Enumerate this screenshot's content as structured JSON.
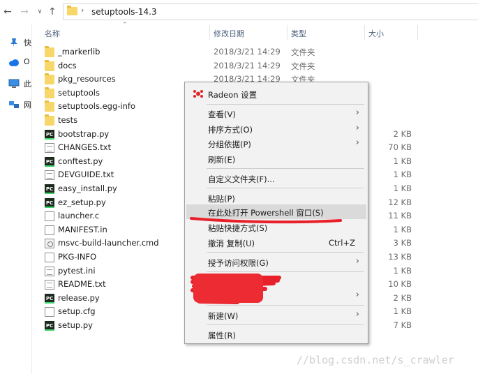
{
  "nav": {
    "back_icon": "arrow-left-icon",
    "forward_icon": "arrow-right-icon",
    "history_icon": "chevron-down-icon",
    "up_icon": "arrow-up-icon",
    "path": "setuptools-14.3"
  },
  "quick_access": [
    {
      "label": "快",
      "icon": "pin-icon"
    },
    {
      "label": "O",
      "icon": "cloud-icon"
    },
    {
      "label": "此",
      "icon": "computer-icon"
    },
    {
      "label": "网",
      "icon": "network-icon"
    }
  ],
  "columns": {
    "name": "名称",
    "date": "修改日期",
    "type": "类型",
    "size": "大小"
  },
  "files": [
    {
      "name": "_markerlib",
      "date": "2018/3/21 14:29",
      "type": "文件夹",
      "size": "",
      "icon": "folder"
    },
    {
      "name": "docs",
      "date": "2018/3/21 14:29",
      "type": "文件夹",
      "size": "",
      "icon": "folder"
    },
    {
      "name": "pkg_resources",
      "date": "2018/3/21 14:29",
      "type": "文件夹",
      "size": "",
      "icon": "folder"
    },
    {
      "name": "setuptools",
      "date": "",
      "type": "",
      "size": "",
      "icon": "folder"
    },
    {
      "name": "setuptools.egg-info",
      "date": "",
      "type": "",
      "size": "",
      "icon": "folder"
    },
    {
      "name": "tests",
      "date": "",
      "type": "",
      "size": "",
      "icon": "folder"
    },
    {
      "name": "bootstrap.py",
      "date": "",
      "type": "",
      "size": "2 KB",
      "icon": "pc"
    },
    {
      "name": "CHANGES.txt",
      "date": "",
      "type": "",
      "size": "70 KB",
      "icon": "txt"
    },
    {
      "name": "conftest.py",
      "date": "",
      "type": "",
      "size": "1 KB",
      "icon": "pc"
    },
    {
      "name": "DEVGUIDE.txt",
      "date": "",
      "type": "",
      "size": "1 KB",
      "icon": "txt"
    },
    {
      "name": "easy_install.py",
      "date": "",
      "type": "",
      "size": "1 KB",
      "icon": "pc"
    },
    {
      "name": "ez_setup.py",
      "date": "",
      "type": "",
      "size": "12 KB",
      "icon": "pc"
    },
    {
      "name": "launcher.c",
      "date": "",
      "type": "",
      "size": "11 KB",
      "icon": "blank"
    },
    {
      "name": "MANIFEST.in",
      "date": "",
      "type": "",
      "size": "1 KB",
      "icon": "blank"
    },
    {
      "name": "msvc-build-launcher.cmd",
      "date": "",
      "type": "",
      "size": "3 KB",
      "icon": "cmd"
    },
    {
      "name": "PKG-INFO",
      "date": "",
      "type": "",
      "size": "13 KB",
      "icon": "blank"
    },
    {
      "name": "pytest.ini",
      "date": "",
      "type": "",
      "size": "1 KB",
      "icon": "txt"
    },
    {
      "name": "README.txt",
      "date": "",
      "type": "",
      "size": "10 KB",
      "icon": "txt"
    },
    {
      "name": "release.py",
      "date": "",
      "type": "",
      "size": "2 KB",
      "icon": "pc"
    },
    {
      "name": "setup.cfg",
      "date": "",
      "type": "",
      "size": "1 KB",
      "icon": "blank"
    },
    {
      "name": "setup.py",
      "date": "",
      "type": "",
      "size": "7 KB",
      "icon": "pc"
    }
  ],
  "menu": {
    "radeon": "Radeon 设置",
    "view": "查看(V)",
    "sort": "排序方式(O)",
    "group": "分组依据(P)",
    "refresh": "刷新(E)",
    "customize": "自定义文件夹(F)...",
    "paste": "粘贴(P)",
    "powershell": "在此处打开 Powershell 窗口(S)",
    "paste_shortcut": "粘贴快捷方式(S)",
    "undo": "撤消 复制(U)",
    "undo_shortcut": "Ctrl+Z",
    "access": "授予访问权限(G)",
    "new": "新建(W)",
    "properties": "属性(R)",
    "submenu_icon": "chevron-right-icon"
  },
  "watermark": "//blog.csdn.net/s_crawler"
}
